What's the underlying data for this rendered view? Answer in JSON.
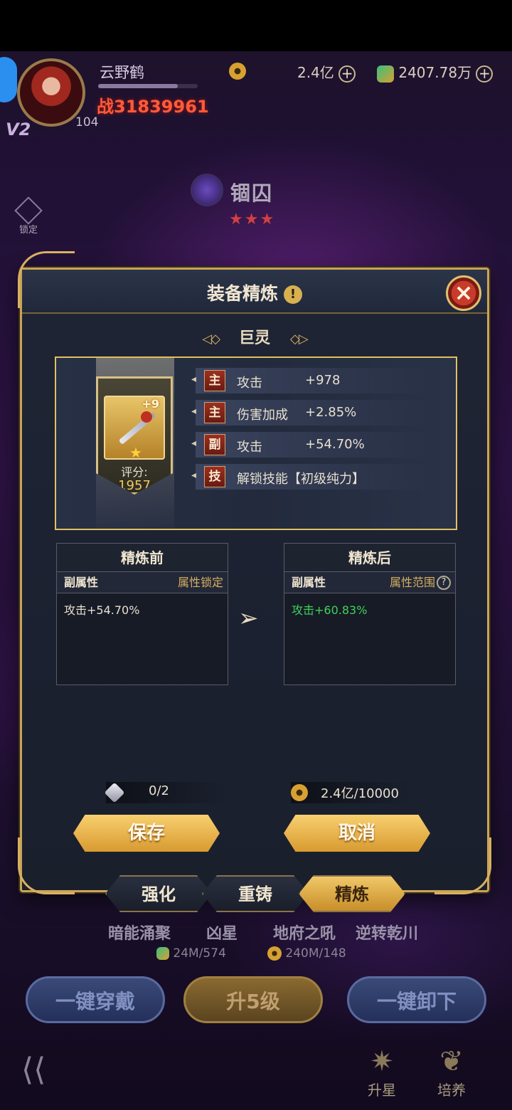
{
  "player": {
    "name": "云野鹤",
    "exp_fraction": 0.8,
    "vip": "V2",
    "level": "104",
    "power_prefix": "战",
    "power": "31839961",
    "gold": "2.4亿",
    "gems": "2407.78万"
  },
  "hero": {
    "name": "锢囚",
    "stars": "★★★",
    "lock_label": "锁定"
  },
  "modal": {
    "title": "装备精炼",
    "equip_name": "巨灵",
    "nav_prev": "◁◇",
    "nav_next": "◇▷",
    "plus_level": "+9",
    "score_label": "评分:",
    "score_value": "1957",
    "attributes": [
      {
        "tag": "主",
        "name": "攻击",
        "value": "+978"
      },
      {
        "tag": "主",
        "name": "伤害加成",
        "value": "+2.85%"
      },
      {
        "tag": "副",
        "name": "攻击",
        "value": "+54.70%"
      },
      {
        "tag": "技",
        "name": "解锁技能【初级纯力】",
        "value": ""
      }
    ],
    "before": {
      "title": "精炼前",
      "sub_label": "副属性",
      "sub_right": "属性锁定",
      "value": "攻击+54.70%"
    },
    "after": {
      "title": "精炼后",
      "sub_label": "副属性",
      "sub_right": "属性范围",
      "value": "攻击+60.83%"
    },
    "cost_stone": "0/2",
    "cost_gold": "2.4亿/10000",
    "save_label": "保存",
    "cancel_label": "取消"
  },
  "tabs": [
    "强化",
    "重铸",
    "精炼"
  ],
  "active_tab": "精炼",
  "background_page": {
    "skills": [
      "暗能涌聚",
      "凶星",
      "地府之吼",
      "逆转乾川"
    ],
    "cost_a": "24M/574",
    "cost_b": "240M/148",
    "btn_equip_all": "一键穿戴",
    "btn_upgrade": "升5级",
    "btn_unequip_all": "一键卸下",
    "nav_star": "升星",
    "nav_train": "培养"
  },
  "colors": {
    "gold_border": "#c9a458",
    "green_value": "#3ed25a",
    "power_red": "#ff5a3c"
  }
}
